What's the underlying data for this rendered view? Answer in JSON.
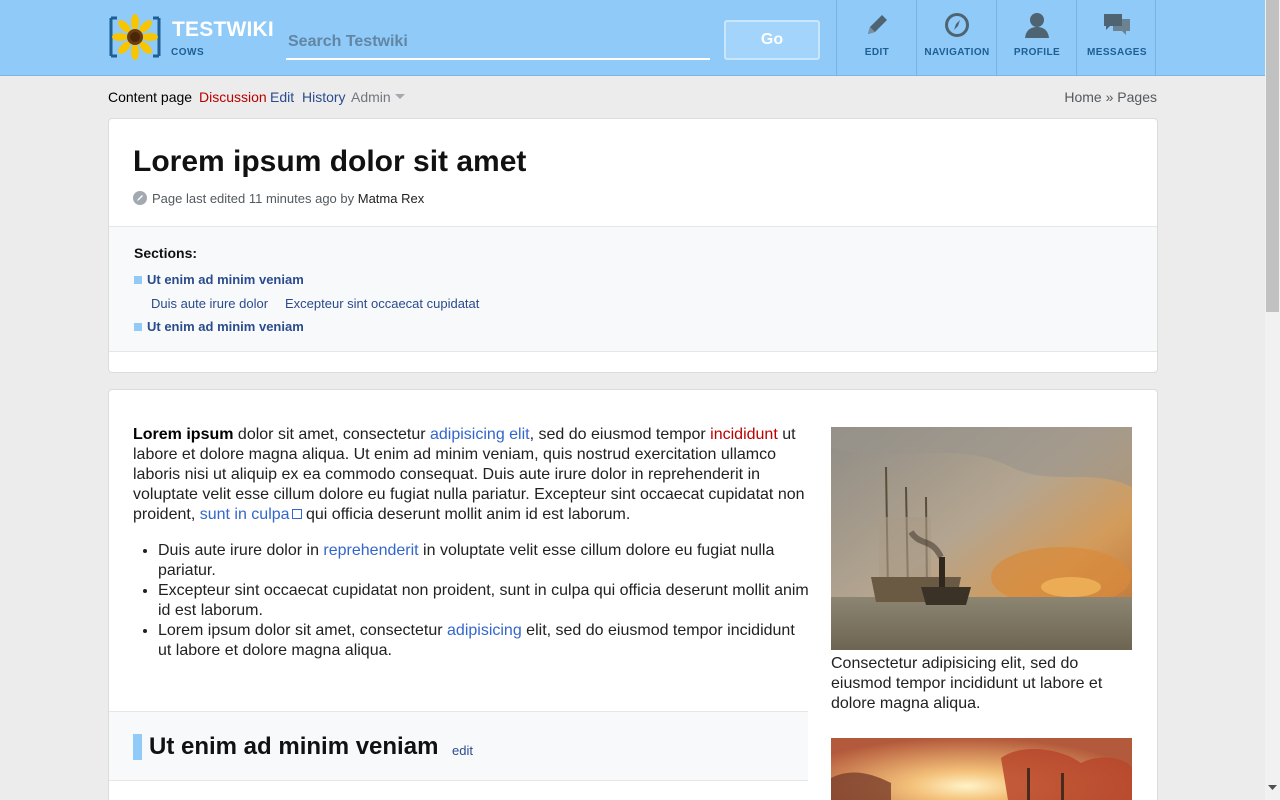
{
  "header": {
    "wiki_name": "TESTWIKI",
    "wiki_tagline": "COWS",
    "search_placeholder": "Search Testwiki",
    "go_label": "Go",
    "nav": [
      {
        "label": "EDIT",
        "icon": "pencil-icon"
      },
      {
        "label": "NAVIGATION",
        "icon": "compass-icon"
      },
      {
        "label": "PROFILE",
        "icon": "user-icon"
      },
      {
        "label": "MESSAGES",
        "icon": "chat-icon"
      }
    ]
  },
  "tabs": {
    "content": "Content page",
    "discussion": "Discussion",
    "edit": "Edit",
    "history": "History",
    "admin": "Admin"
  },
  "breadcrumb": {
    "home": "Home",
    "sep": "»",
    "pages": "Pages"
  },
  "page": {
    "title": "Lorem ipsum dolor sit amet",
    "last_edited_prefix": "Page last edited 11 minutes ago by",
    "last_edited_author": "Matma Rex"
  },
  "toc": {
    "title": "Sections:",
    "items": [
      "Ut enim ad minim veniam",
      "Duis aute irure dolor",
      "Excepteur sint occaecat cupidatat",
      "Ut enim ad minim veniam"
    ]
  },
  "article": {
    "p1_bold": "Lorem ipsum",
    "p1_t1": " dolor sit amet, consectetur ",
    "p1_link1": "adipisicing elit",
    "p1_t2": ", sed do eiusmod tempor ",
    "p1_link2": "incididunt",
    "p1_t3": " ut labore et dolore magna aliqua. Ut enim ad minim veniam, quis nostrud exercitation ullamco laboris nisi ut aliquip ex ea commodo consequat. Duis aute irure dolor in reprehenderit in voluptate velit esse cillum dolore eu fugiat nulla pariatur. Excepteur sint occaecat cupidatat non proident, ",
    "p1_link3": "sunt in culpa",
    "p1_t4": " qui officia deserunt mollit anim id est laborum.",
    "li1_t1": "Duis aute irure dolor in ",
    "li1_link": "reprehenderit",
    "li1_t2": " in voluptate velit esse cillum dolore eu fugiat nulla pariatur.",
    "li2": "Excepteur sint occaecat cupidatat non proident, sunt in culpa qui officia deserunt mollit anim id est laborum.",
    "li3_t1": "Lorem ipsum dolor sit amet, consectetur ",
    "li3_link": "adipisicing",
    "li3_t2": " elit, sed do eiusmod tempor incididunt ut labore et dolore magna aliqua.",
    "section_title": "Ut enim ad minim veniam",
    "section_edit": "edit",
    "caption1": "Consectetur adipisicing elit, sed do eiusmod tempor incididunt ut labore et dolore magna aliqua."
  },
  "colors": {
    "header_bg": "#8fcaf8",
    "link": "#2a4b8d",
    "redlink": "#ba0000",
    "accent": "#8fcaf8"
  }
}
